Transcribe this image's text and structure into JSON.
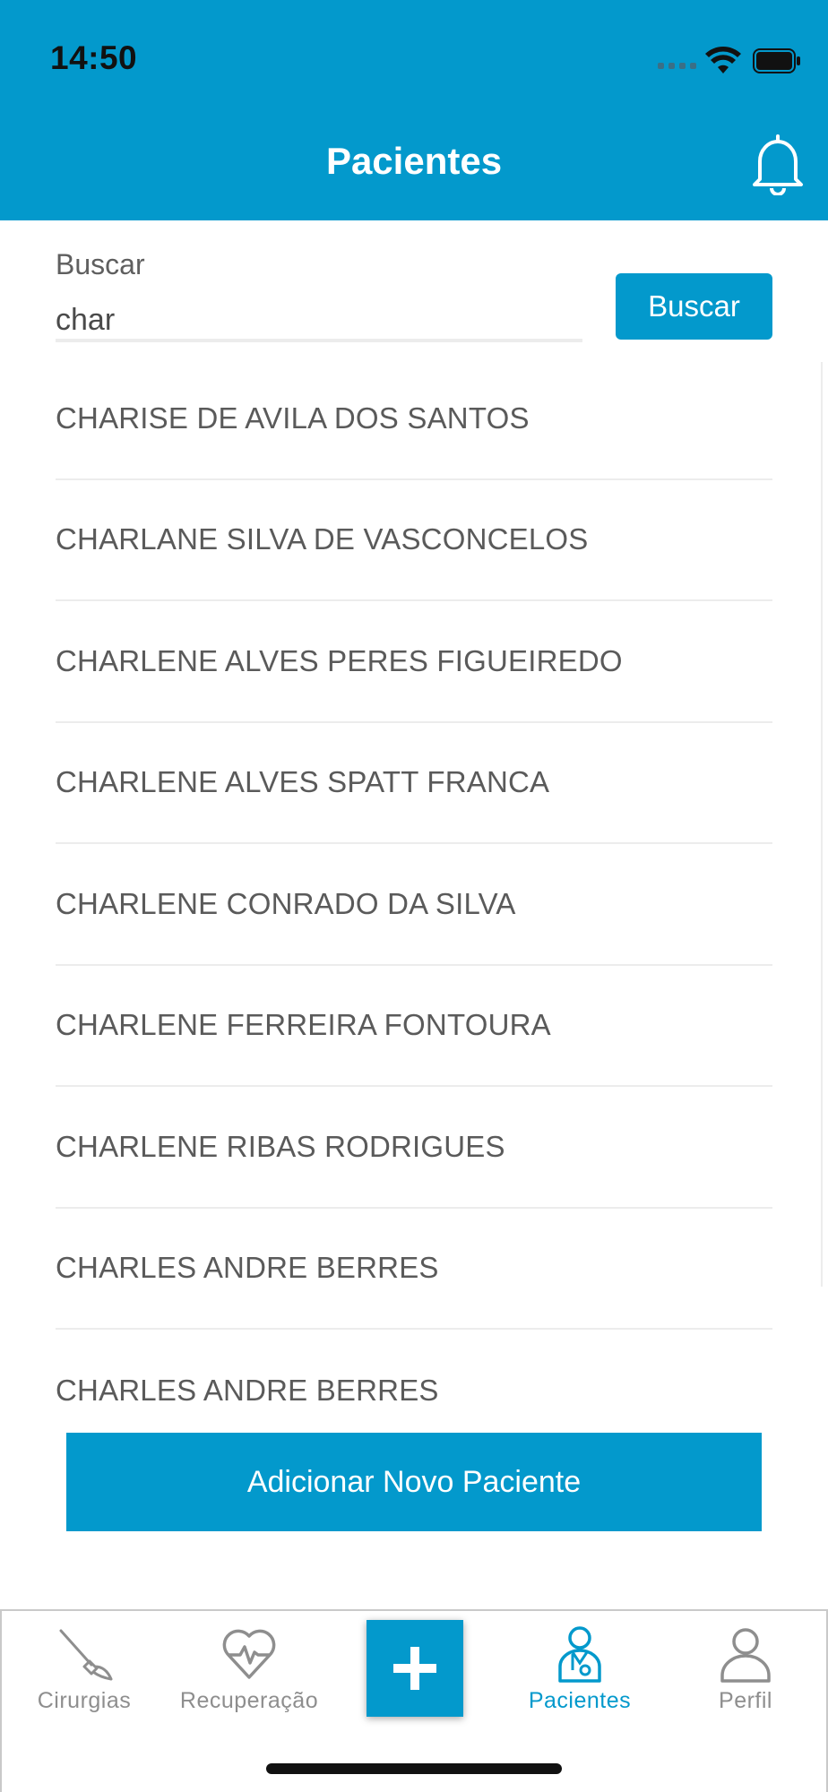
{
  "status_bar": {
    "time": "14:50"
  },
  "header": {
    "title": "Pacientes",
    "notification_icon": "bell-icon"
  },
  "search": {
    "label": "Buscar",
    "value": "char",
    "button_label": "Buscar"
  },
  "patients": [
    {
      "name": "CHARISE DE AVILA DOS SANTOS"
    },
    {
      "name": "CHARLANE SILVA DE VASCONCELOS"
    },
    {
      "name": "CHARLENE ALVES PERES FIGUEIREDO"
    },
    {
      "name": "CHARLENE ALVES SPATT FRANCA"
    },
    {
      "name": "CHARLENE CONRADO DA SILVA"
    },
    {
      "name": "CHARLENE FERREIRA FONTOURA"
    },
    {
      "name": "CHARLENE RIBAS RODRIGUES"
    },
    {
      "name": "CHARLES ANDRE BERRES"
    },
    {
      "name": "CHARLES ANDRE BERRES"
    }
  ],
  "add_patient_label": "Adicionar Novo Paciente",
  "tabbar": {
    "tabs": [
      {
        "label": "Cirurgias",
        "icon": "scalpel-icon",
        "active": false
      },
      {
        "label": "Recuperação",
        "icon": "heart-pulse-icon",
        "active": false
      },
      {
        "label": "",
        "icon": "plus-icon",
        "active": false
      },
      {
        "label": "Pacientes",
        "icon": "doctor-icon",
        "active": true
      },
      {
        "label": "Perfil",
        "icon": "user-icon",
        "active": false
      }
    ]
  },
  "colors": {
    "primary": "#0399cc",
    "text": "#5a5a5a",
    "inactive": "#8e8e8e"
  }
}
